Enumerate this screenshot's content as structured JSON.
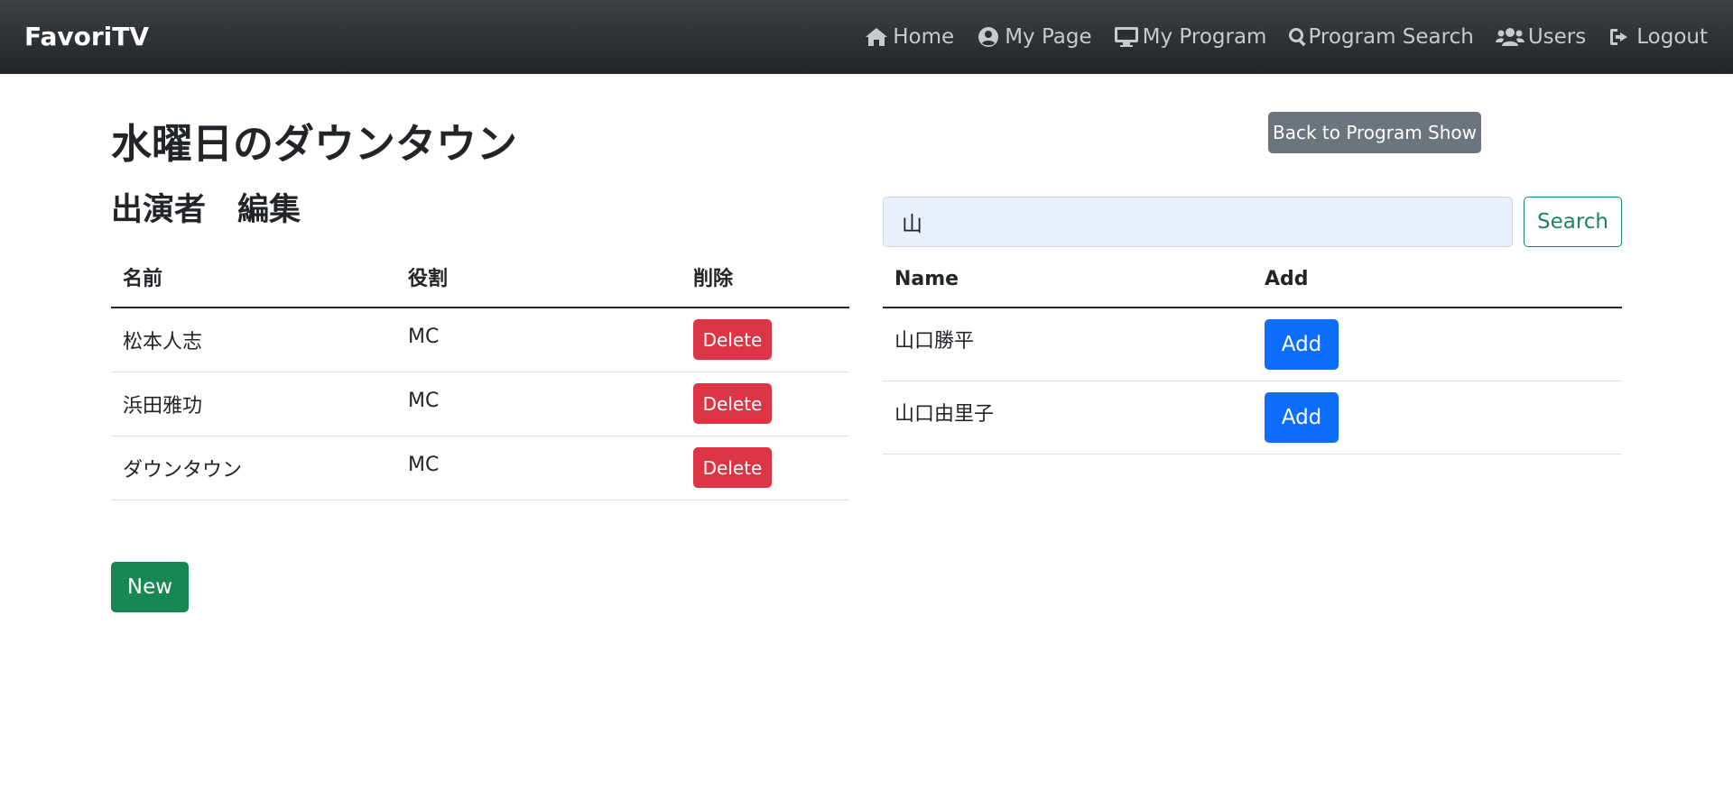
{
  "navbar": {
    "brand": "FavoriTV",
    "links": [
      {
        "label": "Home",
        "icon": "home-icon"
      },
      {
        "label": "My Page",
        "icon": "user-circle-icon"
      },
      {
        "label": "My Program",
        "icon": "desktop-icon"
      },
      {
        "label": "Program Search",
        "icon": "search-icon"
      },
      {
        "label": "Users",
        "icon": "users-icon"
      },
      {
        "label": "Logout",
        "icon": "logout-icon"
      }
    ]
  },
  "page": {
    "title": "水曜日のダウンタウン",
    "section_title": "出演者　編集",
    "back_button": "Back to Program Show",
    "new_button": "New"
  },
  "cast_table": {
    "headers": [
      "名前",
      "役割",
      "削除"
    ],
    "rows": [
      {
        "name": "松本人志",
        "role": "MC",
        "action": "Delete"
      },
      {
        "name": "浜田雅功",
        "role": "MC",
        "action": "Delete"
      },
      {
        "name": "ダウンタウン",
        "role": "MC",
        "action": "Delete"
      }
    ]
  },
  "search": {
    "value": "山",
    "button": "Search"
  },
  "results_table": {
    "headers": [
      "Name",
      "Add"
    ],
    "rows": [
      {
        "name": "山口勝平",
        "action": "Add"
      },
      {
        "name": "山口由里子",
        "action": "Add"
      }
    ]
  },
  "colors": {
    "navbar": "#212529",
    "danger": "#dc3545",
    "primary": "#0d6efd",
    "success": "#198754",
    "secondary": "#6c757d"
  }
}
